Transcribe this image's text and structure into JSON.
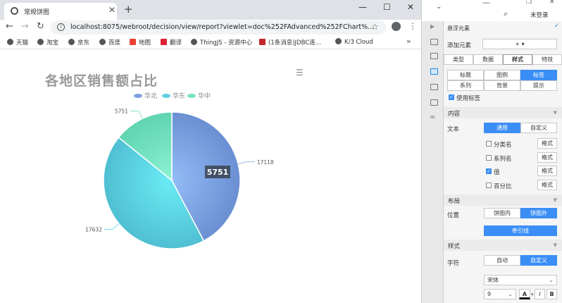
{
  "browser": {
    "tab_title": "常规饼图",
    "url": "localhost:8075/webroot/decision/view/report?viewlet=doc%252FAdvanced%252FChart%...",
    "bookmarks": [
      "天猫",
      "淘宝",
      "京东",
      "百度",
      "地图",
      "翻译",
      "ThingJS - 资源中心",
      "(1条消息)JDBC连...",
      "K/3 Cloud"
    ]
  },
  "chart_data": {
    "type": "pie",
    "title": "各地区销售额占比",
    "categories": [
      "华北",
      "华东",
      "华中"
    ],
    "values": [
      17118,
      17632,
      5751
    ],
    "colors": [
      "#7aa0dc",
      "#5fd0e0",
      "#7ae0be"
    ],
    "tooltip_value": "5751",
    "legend_position": "top"
  },
  "panel": {
    "login": "未登录",
    "header": "悬浮元素",
    "add_element": "添加元素",
    "add_symbol": "+",
    "tabs": [
      "类型",
      "数据",
      "样式",
      "特效"
    ],
    "subtabs": [
      "标题",
      "图例",
      "标签",
      "系列",
      "背景",
      "提示"
    ],
    "use_label": "使用标签",
    "sections": {
      "content": "内容",
      "layout": "布局",
      "style": "样式"
    },
    "text_label": "文本",
    "text_options": [
      "通用",
      "自定义"
    ],
    "checkboxes": [
      "分类名",
      "系列名",
      "值",
      "百分比"
    ],
    "format_label": "格式",
    "position_label": "位置",
    "position_options": [
      "饼图内",
      "饼图外"
    ],
    "leader_line": "牵引线",
    "char_label": "字符",
    "char_options": [
      "自动",
      "自定义"
    ],
    "font_name": "宋体",
    "font_size": "9",
    "font_btns": [
      "A",
      "I",
      "B"
    ]
  }
}
